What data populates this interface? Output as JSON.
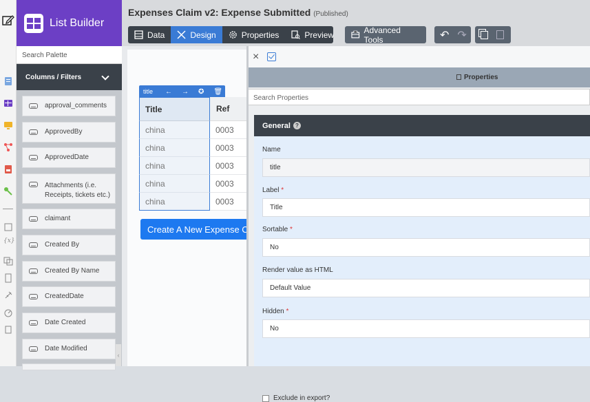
{
  "app": {
    "name": "List Builder"
  },
  "palette": {
    "search_placeholder": "Search Palette",
    "section_label": "Columns / Filters",
    "items": [
      "approval_comments",
      "ApprovedBy",
      "ApprovedDate",
      "Attachments (i.e. Receipts, tickets etc.)",
      "claimant",
      "Created By",
      "Created By Name",
      "CreatedDate",
      "Date Created",
      "Date Modified"
    ]
  },
  "header": {
    "title": "Expenses Claim v2: Expense Submitted",
    "status": "(Published)"
  },
  "toolbar": {
    "data": "Data",
    "design": "Design",
    "properties": "Properties",
    "preview": "Preview",
    "advanced_tools": "Advanced Tools"
  },
  "column_tools": {
    "label": "title"
  },
  "grid": {
    "headers": [
      "Title",
      "Ref"
    ],
    "rows": [
      [
        "china",
        "0003"
      ],
      [
        "china",
        "0003"
      ],
      [
        "china",
        "0003"
      ],
      [
        "china",
        "0003"
      ],
      [
        "china",
        "0003"
      ]
    ]
  },
  "create_button": "Create A New Expense Claim",
  "properties": {
    "header": "Properties",
    "search_placeholder": "Search Properties",
    "section": "General",
    "help": "?",
    "name_label": "Name",
    "name_value": "title",
    "label_label": "Label",
    "label_value": "Title",
    "sortable_label": "Sortable",
    "sortable_value": "No",
    "render_html_label": "Render value as HTML",
    "render_html_value": "Default Value",
    "hidden_label": "Hidden",
    "hidden_value": "No",
    "exclude_label": "Exclude in export?",
    "required_mark": "*"
  },
  "colors": {
    "brand": "#6c3fc5",
    "accent": "#3a7bd5",
    "dark": "#3a4149",
    "create": "#1d79f0"
  }
}
